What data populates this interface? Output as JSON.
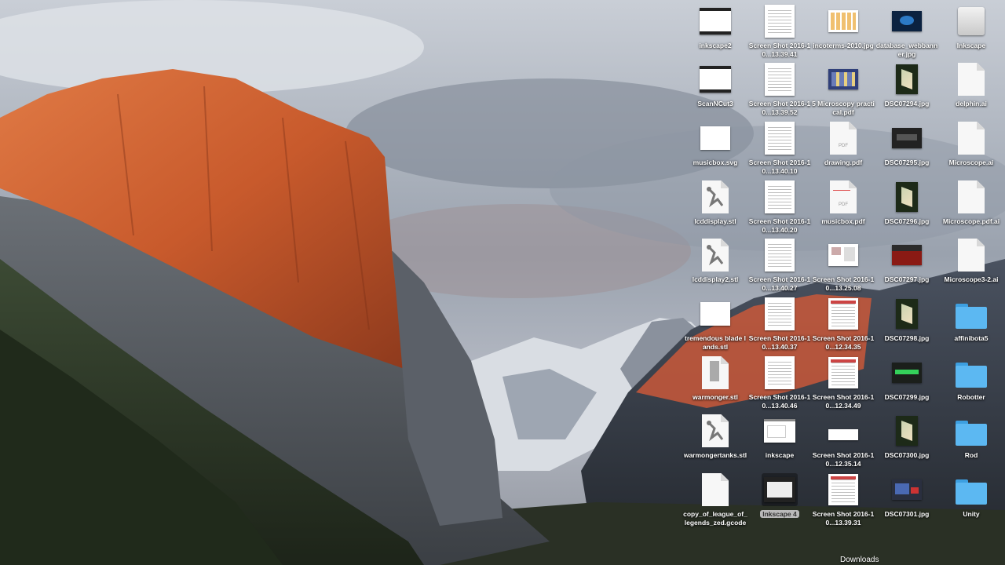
{
  "desktop": {
    "stack_label": "Downloads",
    "items": [
      {
        "label": "inkscape2",
        "icon": "app-window-thumbnail-icon",
        "kind": "window"
      },
      {
        "label": "Screen Shot 2016-10...13.39.41",
        "icon": "screenshot-thumbnail-icon",
        "kind": "sheet"
      },
      {
        "label": "incoterms-2010.jpg",
        "icon": "image-thumbnail-icon",
        "kind": "chart"
      },
      {
        "label": "database_webbanner.jpg",
        "icon": "image-thumbnail-icon",
        "kind": "darkblue"
      },
      {
        "label": "Inkscape",
        "icon": "disk-image-icon",
        "kind": "drive"
      },
      {
        "label": "ScanNCut3",
        "icon": "app-window-thumbnail-icon",
        "kind": "window"
      },
      {
        "label": "Screen Shot 2016-10...13.39.52",
        "icon": "screenshot-thumbnail-icon",
        "kind": "sheet"
      },
      {
        "label": "5 Microscopy practical.pdf",
        "icon": "pdf-thumbnail-icon",
        "kind": "photo"
      },
      {
        "label": "DSC07294.jpg",
        "icon": "photo-thumbnail-icon",
        "kind": "greenphoto"
      },
      {
        "label": "delphin.ai",
        "icon": "document-icon",
        "kind": "doc"
      },
      {
        "label": "musicbox.svg",
        "icon": "svg-document-icon",
        "kind": "blank"
      },
      {
        "label": "Screen Shot 2016-10...13.40.10",
        "icon": "screenshot-thumbnail-icon",
        "kind": "sheet"
      },
      {
        "label": "drawing.pdf",
        "icon": "pdf-document-icon",
        "kind": "pdf"
      },
      {
        "label": "DSC07295.jpg",
        "icon": "photo-thumbnail-icon",
        "kind": "darkphoto"
      },
      {
        "label": "Microscope.ai",
        "icon": "document-icon",
        "kind": "doc"
      },
      {
        "label": "lcddisplay.stl",
        "icon": "stl-model-icon",
        "kind": "stl"
      },
      {
        "label": "Screen Shot 2016-10...13.40.20",
        "icon": "screenshot-thumbnail-icon",
        "kind": "sheet"
      },
      {
        "label": "musicbox.pdf",
        "icon": "pdf-document-icon",
        "kind": "pdfred"
      },
      {
        "label": "DSC07296.jpg",
        "icon": "photo-thumbnail-icon",
        "kind": "greenphoto"
      },
      {
        "label": "Microscope.pdf.ai",
        "icon": "document-icon",
        "kind": "doc"
      },
      {
        "label": "lcddisplay2.stl",
        "icon": "stl-model-icon",
        "kind": "stl"
      },
      {
        "label": "Screen Shot 2016-10...13.40.27",
        "icon": "screenshot-thumbnail-icon",
        "kind": "sheet"
      },
      {
        "label": "Screen Shot 2016-10...13.25.08",
        "icon": "screenshot-thumbnail-icon",
        "kind": "layout"
      },
      {
        "label": "DSC07297.jpg",
        "icon": "photo-thumbnail-icon",
        "kind": "redphoto"
      },
      {
        "label": "Microscope3-2.ai",
        "icon": "document-icon",
        "kind": "doc"
      },
      {
        "label": "tremendous blade lands.stl",
        "icon": "stl-model-icon",
        "kind": "blank"
      },
      {
        "label": "Screen Shot 2016-10...13.40.37",
        "icon": "screenshot-thumbnail-icon",
        "kind": "sheet"
      },
      {
        "label": "Screen Shot 2016-10...12.34.35",
        "icon": "screenshot-thumbnail-icon",
        "kind": "table"
      },
      {
        "label": "DSC07298.jpg",
        "icon": "photo-thumbnail-icon",
        "kind": "greenphoto"
      },
      {
        "label": "affinibota5",
        "icon": "folder-icon",
        "kind": "folder"
      },
      {
        "label": "warmonger.stl",
        "icon": "stl-model-icon",
        "kind": "stl2"
      },
      {
        "label": "Screen Shot 2016-10...13.40.46",
        "icon": "screenshot-thumbnail-icon",
        "kind": "sheet"
      },
      {
        "label": "Screen Shot 2016-10...12.34.49",
        "icon": "screenshot-thumbnail-icon",
        "kind": "table"
      },
      {
        "label": "DSC07299.jpg",
        "icon": "photo-thumbnail-icon",
        "kind": "greenbar"
      },
      {
        "label": "Robotter",
        "icon": "folder-icon",
        "kind": "folder"
      },
      {
        "label": "warmongertanks.stl",
        "icon": "stl-model-icon",
        "kind": "stl"
      },
      {
        "label": "inkscape",
        "icon": "app-window-thumbnail-icon",
        "kind": "window2"
      },
      {
        "label": "Screen Shot 2016-10...12.35.14",
        "icon": "screenshot-thumbnail-icon",
        "kind": "thin"
      },
      {
        "label": "DSC07300.jpg",
        "icon": "photo-thumbnail-icon",
        "kind": "greenphoto"
      },
      {
        "label": "Rod",
        "icon": "folder-icon",
        "kind": "folder"
      },
      {
        "label": "copy_of_league_of_legends_zed.gcode",
        "icon": "gcode-document-icon",
        "kind": "doc"
      },
      {
        "label": "Inkscape 4",
        "icon": "app-window-thumbnail-icon",
        "kind": "window3",
        "selected": true
      },
      {
        "label": "Screen Shot 2016-10...13.39.31",
        "icon": "screenshot-thumbnail-icon",
        "kind": "table"
      },
      {
        "label": "DSC07301.jpg",
        "icon": "photo-thumbnail-icon",
        "kind": "bluephoto"
      },
      {
        "label": "Unity",
        "icon": "folder-icon",
        "kind": "folder"
      }
    ]
  }
}
